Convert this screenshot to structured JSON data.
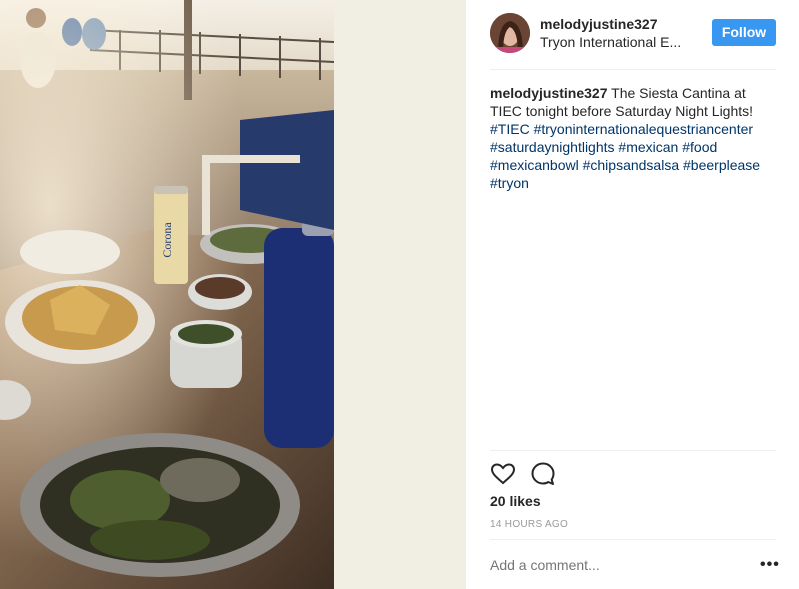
{
  "post": {
    "username": "melodyjustine327",
    "location": "Tryon International E...",
    "follow_label": "Follow",
    "caption_user": "melodyjustine327",
    "caption_text": "The Siesta Cantina at TIEC tonight before Saturday Night Lights!",
    "hashtags": [
      "#TIEC",
      "#tryoninternationalequestriancenter",
      "#saturdaynightlights",
      "#mexican",
      "#food",
      "#mexicanbowl",
      "#chipsandsalsa",
      "#beerplease",
      "#tryon"
    ],
    "likes": "20 likes",
    "timestamp": "14 HOURS AGO",
    "comment_placeholder": "Add a comment...",
    "more_label": "•••",
    "can_label": "Corona"
  },
  "icons": {
    "like": "heart-icon",
    "comment": "comment-bubble-icon",
    "more": "more-options-icon"
  },
  "colors": {
    "follow_button": "#3897f0",
    "hashtag": "#003569",
    "muted": "#999999",
    "side_background": "#f1efe3"
  }
}
